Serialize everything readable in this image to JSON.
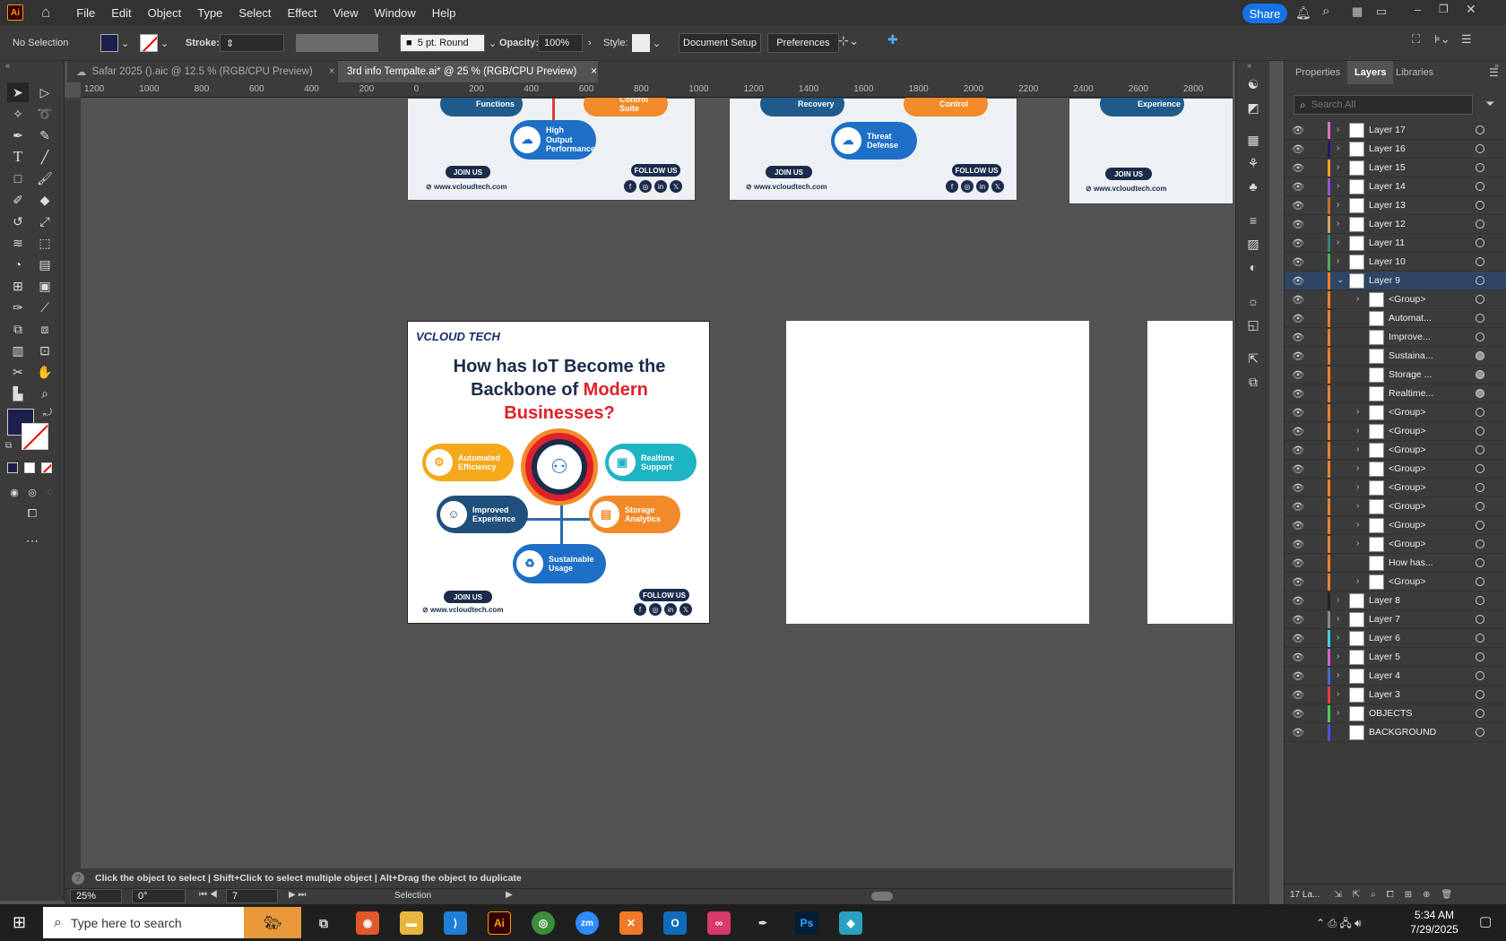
{
  "app": {
    "logo": "Ai",
    "menus": [
      "File",
      "Edit",
      "Object",
      "Type",
      "Select",
      "Effect",
      "View",
      "Window",
      "Help"
    ],
    "share_label": "Share"
  },
  "control": {
    "selection": "No Selection",
    "stroke_label": "Stroke:",
    "brush": "5 pt. Round",
    "opacity_label": "Opacity:",
    "opacity": "100%",
    "style_label": "Style:",
    "doc_setup": "Document Setup",
    "preferences": "Preferences",
    "fill_color": "#1b1f4a"
  },
  "tabs": [
    {
      "label": "Safar 2025 ().aic @ 12.5 % (RGB/CPU Preview)",
      "close": "×"
    },
    {
      "label": "3rd info Tempalte.ai* @ 25 % (RGB/CPU Preview)",
      "close": "×"
    }
  ],
  "ruler": {
    "top": [
      "1200",
      "1000",
      "800",
      "600",
      "400",
      "200",
      "0",
      "200",
      "400",
      "600",
      "800",
      "1000",
      "1200",
      "1400",
      "1600",
      "1800",
      "2000",
      "2200",
      "2400",
      "2600",
      "2800"
    ]
  },
  "artboards": {
    "top1": {
      "btn1": "Functions",
      "btn2": "Control Suite",
      "btn3": "High Output Performance",
      "join": "JOIN US",
      "follow": "FOLLOW US",
      "url": "www.vcloudtech.com"
    },
    "top2": {
      "btn1": "Recovery",
      "btn2": "Control",
      "btn3": "Threat Defense",
      "join": "JOIN US",
      "follow": "FOLLOW US",
      "url": "www.vcloudtech.com"
    },
    "top3": {
      "btn1": "Experience",
      "join": "JOIN US",
      "url": "www.vcloudtech.com"
    },
    "main": {
      "brand": "VCLOUD TECH",
      "title_line1": "How has IoT Become the",
      "title_line2a": "Backbone of ",
      "title_line2b": "Modern",
      "title_line3": "Businesses?",
      "items": [
        "Automated Efficiency",
        "Realtime Support",
        "Improved Experience",
        "Storage Analytics",
        "Sustainable Usage"
      ],
      "join": "JOIN US",
      "follow": "FOLLOW US",
      "url": "www.vcloudtech.com"
    }
  },
  "status": {
    "hint": "Click the object to select  |  Shift+Click to select multiple object  |  Alt+Drag the object to duplicate",
    "zoom": "25%",
    "rotate": "0°",
    "artboard": "7",
    "tool": "Selection"
  },
  "panel": {
    "tabs": [
      "Properties",
      "Layers",
      "Libraries"
    ],
    "search_placeholder": "Search All",
    "layers": [
      {
        "name": "Layer 17",
        "color": "#e26fbf",
        "exp": false,
        "indent": 0,
        "filled": false
      },
      {
        "name": "Layer 16",
        "color": "#1b1f6f",
        "exp": false,
        "indent": 0,
        "filled": false
      },
      {
        "name": "Layer 15",
        "color": "#f29b2a",
        "exp": false,
        "indent": 0,
        "filled": false
      },
      {
        "name": "Layer 14",
        "color": "#9a4ddb",
        "exp": false,
        "indent": 0,
        "filled": false
      },
      {
        "name": "Layer 13",
        "color": "#c96b2b",
        "exp": false,
        "indent": 0,
        "filled": false
      },
      {
        "name": "Layer 12",
        "color": "#d8a25a",
        "exp": false,
        "indent": 0,
        "filled": false
      },
      {
        "name": "Layer 11",
        "color": "#2b8a7a",
        "exp": false,
        "indent": 0,
        "filled": false
      },
      {
        "name": "Layer 10",
        "color": "#4caf50",
        "exp": false,
        "indent": 0,
        "filled": false
      },
      {
        "name": "Layer 9",
        "color": "#f07f2a",
        "exp": true,
        "indent": 0,
        "filled": false,
        "selected": true
      },
      {
        "name": "<Group>",
        "color": "#f07f2a",
        "exp": false,
        "indent": 1,
        "filled": false
      },
      {
        "name": "Automat...",
        "color": "#f07f2a",
        "exp": null,
        "indent": 1,
        "filled": false
      },
      {
        "name": "Improve...",
        "color": "#f07f2a",
        "exp": null,
        "indent": 1,
        "filled": false
      },
      {
        "name": "Sustaina...",
        "color": "#f07f2a",
        "exp": null,
        "indent": 1,
        "filled": true
      },
      {
        "name": "Storage ...",
        "color": "#f07f2a",
        "exp": null,
        "indent": 1,
        "filled": true
      },
      {
        "name": "Realtime...",
        "color": "#f07f2a",
        "exp": null,
        "indent": 1,
        "filled": true
      },
      {
        "name": "<Group>",
        "color": "#f07f2a",
        "exp": false,
        "indent": 1,
        "filled": false
      },
      {
        "name": "<Group>",
        "color": "#f07f2a",
        "exp": false,
        "indent": 1,
        "filled": false
      },
      {
        "name": "<Group>",
        "color": "#f07f2a",
        "exp": false,
        "indent": 1,
        "filled": false
      },
      {
        "name": "<Group>",
        "color": "#f07f2a",
        "exp": false,
        "indent": 1,
        "filled": false
      },
      {
        "name": "<Group>",
        "color": "#f07f2a",
        "exp": false,
        "indent": 1,
        "filled": false
      },
      {
        "name": "<Group>",
        "color": "#f07f2a",
        "exp": false,
        "indent": 1,
        "filled": false
      },
      {
        "name": "<Group>",
        "color": "#f07f2a",
        "exp": false,
        "indent": 1,
        "filled": false
      },
      {
        "name": "<Group>",
        "color": "#f07f2a",
        "exp": false,
        "indent": 1,
        "filled": false
      },
      {
        "name": "How has...",
        "color": "#f07f2a",
        "exp": null,
        "indent": 1,
        "filled": false
      },
      {
        "name": "<Group>",
        "color": "#f07f2a",
        "exp": false,
        "indent": 1,
        "filled": false
      },
      {
        "name": "Layer 8",
        "color": "#222222",
        "exp": false,
        "indent": 0,
        "filled": false
      },
      {
        "name": "Layer 7",
        "color": "#888888",
        "exp": false,
        "indent": 0,
        "filled": false
      },
      {
        "name": "Layer 6",
        "color": "#3fd0e0",
        "exp": false,
        "indent": 0,
        "filled": false
      },
      {
        "name": "Layer 5",
        "color": "#d35fd0",
        "exp": false,
        "indent": 0,
        "filled": false
      },
      {
        "name": "Layer 4",
        "color": "#3b6fe0",
        "exp": false,
        "indent": 0,
        "filled": false
      },
      {
        "name": "Layer 3",
        "color": "#e04040",
        "exp": false,
        "indent": 0,
        "filled": false
      },
      {
        "name": "OBJECTS",
        "color": "#4cd04c",
        "exp": false,
        "indent": 0,
        "filled": false
      },
      {
        "name": "BACKGROUND",
        "color": "#5050e0",
        "exp": null,
        "indent": 0,
        "filled": false
      }
    ],
    "footer_count": "17 La..."
  },
  "taskbar": {
    "search": "Type here to search",
    "time": "5:34 AM",
    "date": "7/29/2025"
  }
}
